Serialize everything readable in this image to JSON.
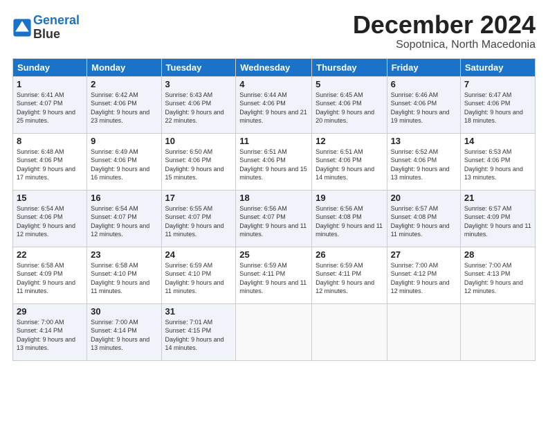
{
  "header": {
    "logo_line1": "General",
    "logo_line2": "Blue",
    "month_title": "December 2024",
    "location": "Sopotnica, North Macedonia"
  },
  "days_of_week": [
    "Sunday",
    "Monday",
    "Tuesday",
    "Wednesday",
    "Thursday",
    "Friday",
    "Saturday"
  ],
  "weeks": [
    [
      {
        "day": "1",
        "sunrise": "6:41 AM",
        "sunset": "4:07 PM",
        "daylight": "9 hours and 25 minutes."
      },
      {
        "day": "2",
        "sunrise": "6:42 AM",
        "sunset": "4:06 PM",
        "daylight": "9 hours and 23 minutes."
      },
      {
        "day": "3",
        "sunrise": "6:43 AM",
        "sunset": "4:06 PM",
        "daylight": "9 hours and 22 minutes."
      },
      {
        "day": "4",
        "sunrise": "6:44 AM",
        "sunset": "4:06 PM",
        "daylight": "9 hours and 21 minutes."
      },
      {
        "day": "5",
        "sunrise": "6:45 AM",
        "sunset": "4:06 PM",
        "daylight": "9 hours and 20 minutes."
      },
      {
        "day": "6",
        "sunrise": "6:46 AM",
        "sunset": "4:06 PM",
        "daylight": "9 hours and 19 minutes."
      },
      {
        "day": "7",
        "sunrise": "6:47 AM",
        "sunset": "4:06 PM",
        "daylight": "9 hours and 18 minutes."
      }
    ],
    [
      {
        "day": "8",
        "sunrise": "6:48 AM",
        "sunset": "4:06 PM",
        "daylight": "9 hours and 17 minutes."
      },
      {
        "day": "9",
        "sunrise": "6:49 AM",
        "sunset": "4:06 PM",
        "daylight": "9 hours and 16 minutes."
      },
      {
        "day": "10",
        "sunrise": "6:50 AM",
        "sunset": "4:06 PM",
        "daylight": "9 hours and 15 minutes."
      },
      {
        "day": "11",
        "sunrise": "6:51 AM",
        "sunset": "4:06 PM",
        "daylight": "9 hours and 15 minutes."
      },
      {
        "day": "12",
        "sunrise": "6:51 AM",
        "sunset": "4:06 PM",
        "daylight": "9 hours and 14 minutes."
      },
      {
        "day": "13",
        "sunrise": "6:52 AM",
        "sunset": "4:06 PM",
        "daylight": "9 hours and 13 minutes."
      },
      {
        "day": "14",
        "sunrise": "6:53 AM",
        "sunset": "4:06 PM",
        "daylight": "9 hours and 13 minutes."
      }
    ],
    [
      {
        "day": "15",
        "sunrise": "6:54 AM",
        "sunset": "4:06 PM",
        "daylight": "9 hours and 12 minutes."
      },
      {
        "day": "16",
        "sunrise": "6:54 AM",
        "sunset": "4:07 PM",
        "daylight": "9 hours and 12 minutes."
      },
      {
        "day": "17",
        "sunrise": "6:55 AM",
        "sunset": "4:07 PM",
        "daylight": "9 hours and 11 minutes."
      },
      {
        "day": "18",
        "sunrise": "6:56 AM",
        "sunset": "4:07 PM",
        "daylight": "9 hours and 11 minutes."
      },
      {
        "day": "19",
        "sunrise": "6:56 AM",
        "sunset": "4:08 PM",
        "daylight": "9 hours and 11 minutes."
      },
      {
        "day": "20",
        "sunrise": "6:57 AM",
        "sunset": "4:08 PM",
        "daylight": "9 hours and 11 minutes."
      },
      {
        "day": "21",
        "sunrise": "6:57 AM",
        "sunset": "4:09 PM",
        "daylight": "9 hours and 11 minutes."
      }
    ],
    [
      {
        "day": "22",
        "sunrise": "6:58 AM",
        "sunset": "4:09 PM",
        "daylight": "9 hours and 11 minutes."
      },
      {
        "day": "23",
        "sunrise": "6:58 AM",
        "sunset": "4:10 PM",
        "daylight": "9 hours and 11 minutes."
      },
      {
        "day": "24",
        "sunrise": "6:59 AM",
        "sunset": "4:10 PM",
        "daylight": "9 hours and 11 minutes."
      },
      {
        "day": "25",
        "sunrise": "6:59 AM",
        "sunset": "4:11 PM",
        "daylight": "9 hours and 11 minutes."
      },
      {
        "day": "26",
        "sunrise": "6:59 AM",
        "sunset": "4:11 PM",
        "daylight": "9 hours and 12 minutes."
      },
      {
        "day": "27",
        "sunrise": "7:00 AM",
        "sunset": "4:12 PM",
        "daylight": "9 hours and 12 minutes."
      },
      {
        "day": "28",
        "sunrise": "7:00 AM",
        "sunset": "4:13 PM",
        "daylight": "9 hours and 12 minutes."
      }
    ],
    [
      {
        "day": "29",
        "sunrise": "7:00 AM",
        "sunset": "4:14 PM",
        "daylight": "9 hours and 13 minutes."
      },
      {
        "day": "30",
        "sunrise": "7:00 AM",
        "sunset": "4:14 PM",
        "daylight": "9 hours and 13 minutes."
      },
      {
        "day": "31",
        "sunrise": "7:01 AM",
        "sunset": "4:15 PM",
        "daylight": "9 hours and 14 minutes."
      },
      null,
      null,
      null,
      null
    ]
  ]
}
